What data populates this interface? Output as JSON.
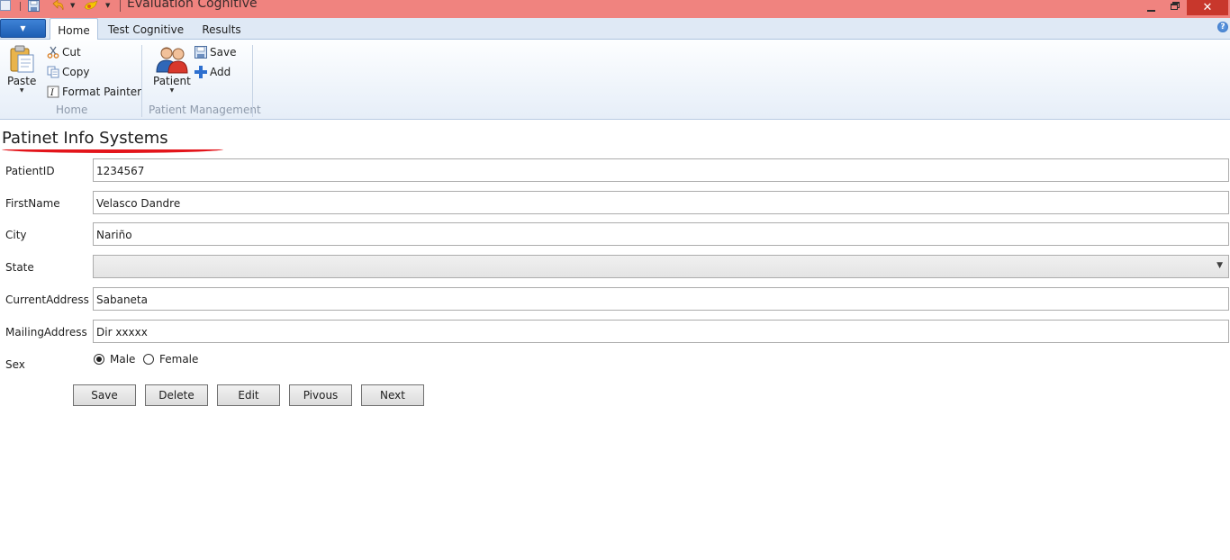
{
  "window": {
    "title": "Evaluation Cognitive",
    "close_glyph": "✕",
    "titlebar_color": "#f0837f"
  },
  "ribbon": {
    "tabs": [
      {
        "label": "Home",
        "selected": true
      },
      {
        "label": "Test Cognitive",
        "selected": false
      },
      {
        "label": "Results",
        "selected": false
      }
    ],
    "groups": {
      "home": {
        "label": "Home",
        "paste": "Paste",
        "cut": "Cut",
        "copy": "Copy",
        "format_painter": "Format Painter"
      },
      "patient_management": {
        "label": "Patient Management",
        "patient": "Patient",
        "save": "Save",
        "add": "Add"
      }
    }
  },
  "form": {
    "title": "Patinet Info Systems",
    "fields": {
      "patient_id": {
        "label": "PatientID",
        "value": "1234567"
      },
      "first_name": {
        "label": "FirstName",
        "value": "Velasco Dandre"
      },
      "city": {
        "label": "City",
        "value": "Nariño"
      },
      "state": {
        "label": "State",
        "value": ""
      },
      "current_address": {
        "label": "CurrentAddress",
        "value": "Sabaneta"
      },
      "mailing_address": {
        "label": "MailingAddress",
        "value": "Dir xxxxx"
      }
    },
    "sex": {
      "label": "Sex",
      "options": [
        {
          "label": "Male",
          "selected": true
        },
        {
          "label": "Female",
          "selected": false
        }
      ]
    },
    "buttons": {
      "save": "Save",
      "delete": "Delete",
      "edit": "Edit",
      "previous": "Pivous",
      "next": "Next"
    }
  },
  "colors": {
    "accent_underline": "#e3151b",
    "app_menu": "#2a6fc6"
  }
}
